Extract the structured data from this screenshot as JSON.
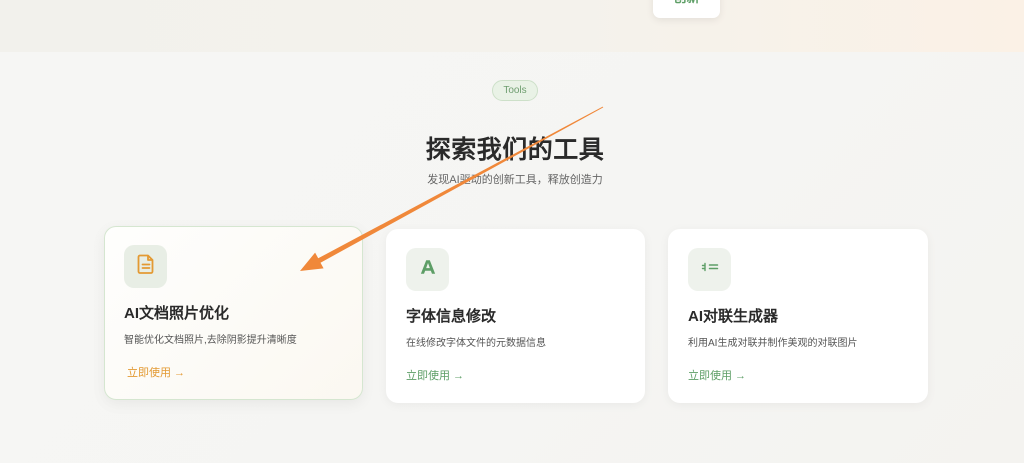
{
  "top_band": {
    "card_text": "创新"
  },
  "section": {
    "badge": "Tools",
    "title": "探索我们的工具",
    "subtitle": "发现AI驱动的创新工具，释放创造力"
  },
  "tools": [
    {
      "icon": "document-icon",
      "title": "AI文档照片优化",
      "description": "智能优化文档照片,去除阴影提升清晰度",
      "link": "立即使用 →",
      "accent": "#e39a33",
      "state": "hovered"
    },
    {
      "icon": "font-icon",
      "title": "字体信息修改",
      "description": "在线修改字体文件的元数据信息",
      "link": "立即使用 →",
      "accent": "#5d9e66"
    },
    {
      "icon": "couplet-icon",
      "title": "AI对联生成器",
      "description": "利用AI生成对联并制作美观的对联图片",
      "link": "立即使用 →",
      "accent": "#5d9e66"
    }
  ],
  "annotation": {
    "type": "arrow",
    "color": "#f0883a",
    "points_to": "tools.0"
  },
  "colors": {
    "background": "#f6f6f4",
    "badge_bg": "#e9f2e6",
    "badge_text": "#6f9e70",
    "title": "#2a2a2a",
    "subtitle": "#666666"
  }
}
